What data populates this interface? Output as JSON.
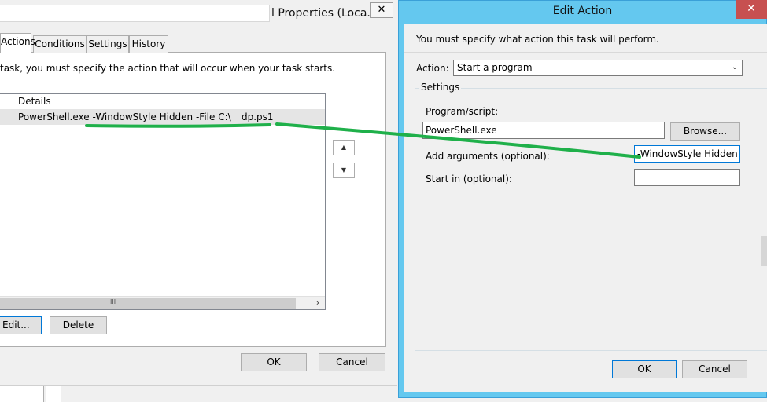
{
  "properties_window": {
    "title": "l Properties (Loca...",
    "close_label": "✕",
    "tabs": [
      {
        "label": "Actions",
        "active": true
      },
      {
        "label": "Conditions",
        "active": false
      },
      {
        "label": "Settings",
        "active": false
      },
      {
        "label": "History",
        "active": false
      }
    ],
    "instructions": "task, you must specify the action that will occur when your task starts.",
    "list": {
      "columns": [
        "Details"
      ],
      "rows": [
        {
          "details": "PowerShell.exe -WindowStyle Hidden -File C:\\",
          "details_tail": "dp.ps1"
        }
      ],
      "scroll_grip": "III",
      "scroll_right_icon": "›"
    },
    "move_up_icon": "▲",
    "move_down_icon": "▼",
    "edit_label": "Edit...",
    "delete_label": "Delete",
    "ok_label": "OK",
    "cancel_label": "Cancel"
  },
  "edit_action": {
    "title": "Edit Action",
    "close_label": "✕",
    "message": "You must specify what action this task will perform.",
    "action_label": "Action:",
    "action_value": "Start a program",
    "dropdown_icon": "⌄",
    "settings_legend": "Settings",
    "program_label": "Program/script:",
    "program_value": "PowerShell.exe",
    "browse_label": "Browse...",
    "arguments_label": "Add arguments (optional):",
    "arguments_value": "-WindowStyle Hidden -F",
    "start_in_label": "Start in (optional):",
    "start_in_value": "",
    "ok_label": "OK",
    "cancel_label": "Cancel"
  },
  "colors": {
    "dialog_frame": "#64c8ef",
    "annotation": "#1fb04a",
    "focus_blue": "#0078d7",
    "close_red": "#c75050"
  }
}
